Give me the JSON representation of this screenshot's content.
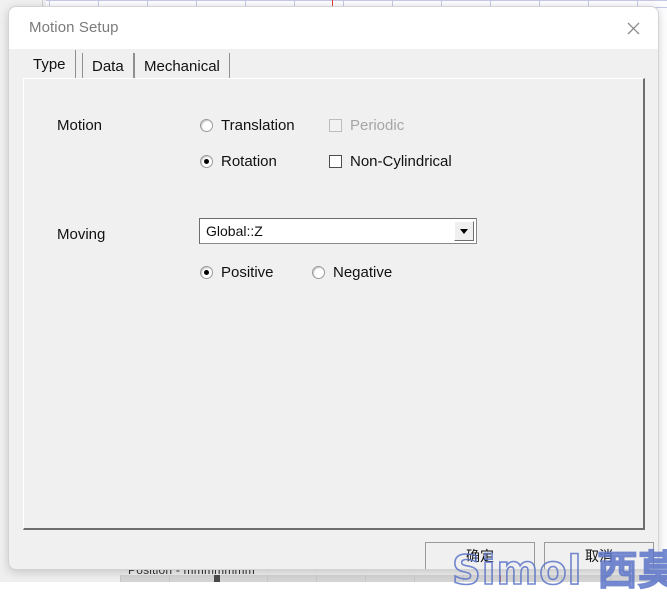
{
  "backdrop": {
    "bottom_text": "Position - mmmmmmm"
  },
  "dialog": {
    "title": "Motion Setup",
    "close_icon": "close-icon",
    "tabs": [
      {
        "label": "Type",
        "active": true
      },
      {
        "label": "Data",
        "active": false
      },
      {
        "label": "Mechanical",
        "active": false
      }
    ],
    "motion": {
      "label": "Motion",
      "options": [
        {
          "label": "Translation",
          "type": "radio",
          "checked": false,
          "disabled": false
        },
        {
          "label": "Periodic",
          "type": "checkbox",
          "checked": false,
          "disabled": true
        },
        {
          "label": "Rotation",
          "type": "radio",
          "checked": true,
          "disabled": false
        },
        {
          "label": "Non-Cylindrical",
          "type": "checkbox",
          "checked": false,
          "disabled": false
        }
      ]
    },
    "moving": {
      "label": "Moving",
      "axis_value": "Global::Z",
      "dropdown_icon": "chevron-down-icon",
      "direction": [
        {
          "label": "Positive",
          "checked": true
        },
        {
          "label": "Negative",
          "checked": false
        }
      ]
    },
    "footer": {
      "ok_label": "确定",
      "cancel_label": "取消"
    }
  },
  "watermark": {
    "text": "Simol 西莫",
    "color": "#5b74c8"
  }
}
